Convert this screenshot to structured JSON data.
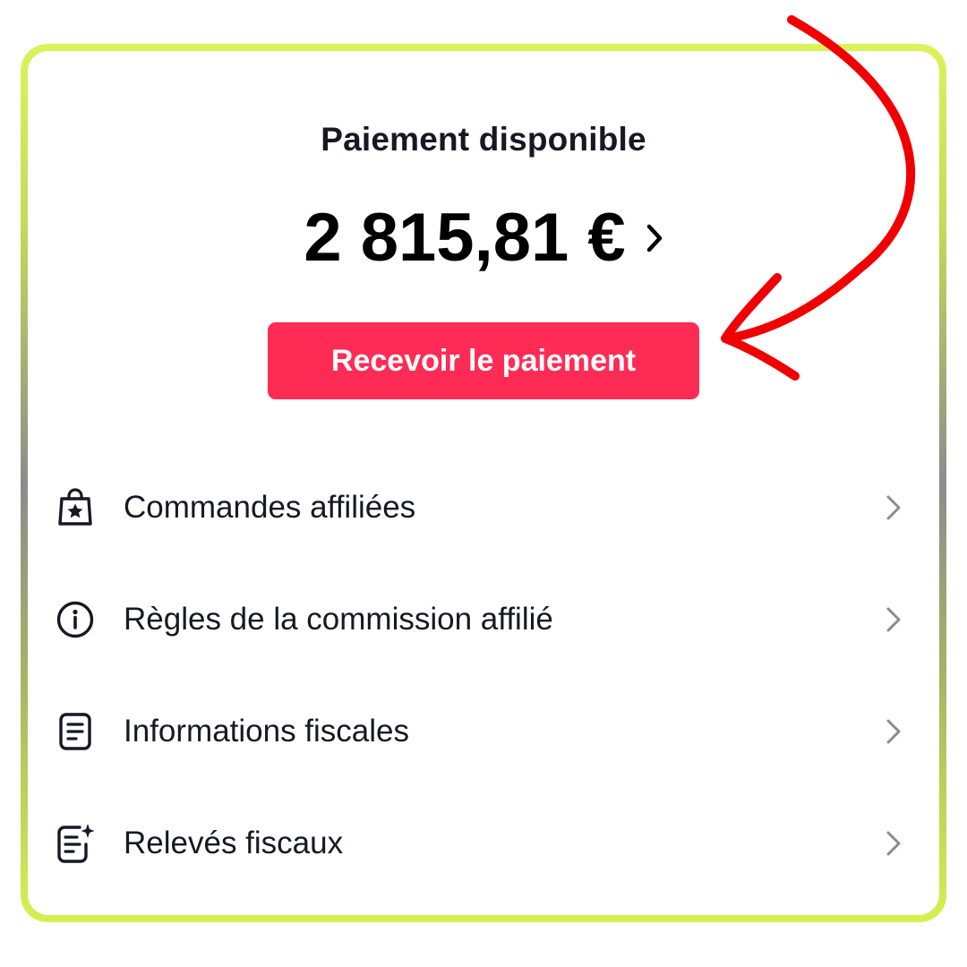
{
  "payout": {
    "title": "Paiement disponible",
    "amount": "2 815,81 €",
    "button_label": "Recevoir le paiement"
  },
  "menu": {
    "items": [
      {
        "label": "Commandes affiliées",
        "icon": "shopping-bag-star-icon"
      },
      {
        "label": "Règles de la commission affilié",
        "icon": "info-circle-icon"
      },
      {
        "label": "Informations fiscales",
        "icon": "document-icon"
      },
      {
        "label": "Relevés fiscaux",
        "icon": "document-sparkle-icon"
      }
    ]
  },
  "colors": {
    "accent": "#fe2c55",
    "annotation_arrow": "#f00000",
    "border_top": "#dcf25a",
    "border_middle": "#8c8c8c",
    "text": "#161823"
  }
}
